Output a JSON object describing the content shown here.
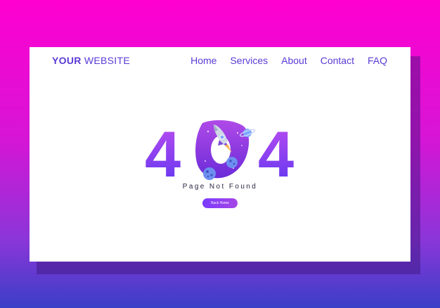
{
  "header": {
    "brand_bold": "YOUR",
    "brand_light": " WEBSITE",
    "nav": [
      "Home",
      "Services",
      "About",
      "Contact",
      "FAQ"
    ]
  },
  "hero": {
    "digit_left": "4",
    "digit_right": "4",
    "subtitle": "Page Not Found",
    "button_label": "Back Home",
    "illustration_icons": [
      "rocket-icon",
      "planet-icon",
      "moon-icon"
    ]
  },
  "colors": {
    "accent": "#5a3bd6",
    "gradient_start": "#ff00d0",
    "gradient_end": "#3a3fc8",
    "digit_gradient_top": "#c04ef0",
    "digit_gradient_bottom": "#5a35f0"
  }
}
